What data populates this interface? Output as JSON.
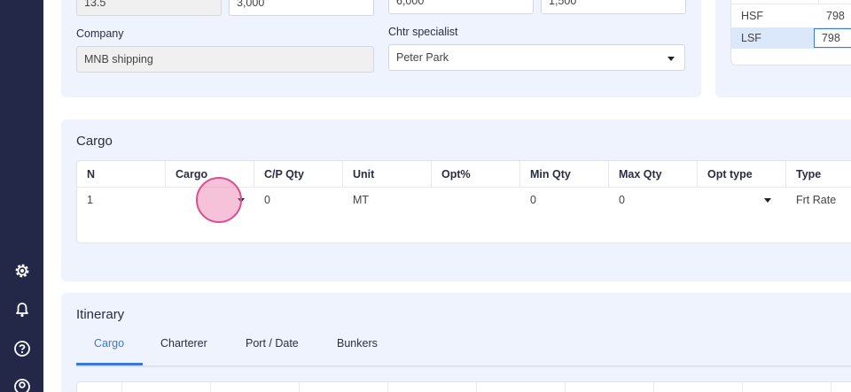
{
  "sidebar": {
    "icons": [
      "gear-icon",
      "bell-icon",
      "help-icon",
      "user-icon"
    ]
  },
  "top_panel": {
    "field_a_value": "13.5",
    "field_b_value": "3,000",
    "field_c_value": "6,000",
    "field_d_value": "1,500",
    "company_label": "Company",
    "company_value": "MNB shipping",
    "chtr_specialist_label": "Chtr specialist",
    "chtr_specialist_value": "Peter Park"
  },
  "bunkers": {
    "rows": [
      {
        "name": "HSF",
        "value": "798"
      },
      {
        "name": "LSF",
        "value": "798"
      }
    ]
  },
  "cargo": {
    "title": "Cargo",
    "columns": [
      "N",
      "Cargo",
      "C/P Qty",
      "Unit",
      "Opt%",
      "Min Qty",
      "Max Qty",
      "Opt type",
      "Type"
    ],
    "rows": [
      {
        "n": "1",
        "cargo": "",
        "cp_qty": "0",
        "unit": "MT",
        "opt_pct": "",
        "min_qty": "0",
        "max_qty": "0",
        "opt_type": "",
        "type": "Frt Rate"
      }
    ]
  },
  "itinerary": {
    "title": "Itinerary",
    "tabs": [
      "Cargo",
      "Charterer",
      "Port / Date",
      "Bunkers"
    ],
    "active_tab": "Cargo"
  },
  "colors": {
    "sidebar": "#232849",
    "panel": "#eef3fd",
    "accent": "#3a78d8",
    "selected_row": "#dbe7fb",
    "cursor": "#d9508f"
  }
}
